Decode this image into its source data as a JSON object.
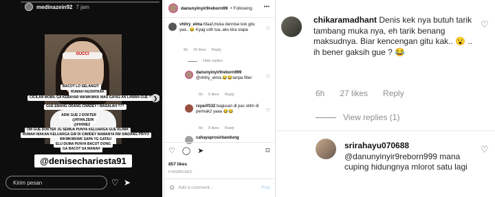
{
  "story": {
    "username": "medinazein92",
    "time": "7 jam",
    "headband": "GUCCI",
    "stickers": [
      "BACOT LO SELANGIT",
      "RUMAH NGONTRAK",
      "CICILAN MOBIL GA KEBAYAR WKWKWKK MAU GAYA2 AN LAWAN GUE ????",
      "GUE EMANG ORANG CIWIDEY ! MASALAH ???",
      "ADIK GUE 2 DOKTER",
      "@RYAN.ZEIN",
      "@FIKRIEZ",
      "OM GUE DOKTER JG SEMUA PUNYA KELUARGA GUE KLINIK",
      "RUMAH MAKAN KELUARGA GW DI CIWIDEY NAMANYA RM SINDANG PRIYO",
      "WKWKWKWK SAPA YG GATAU",
      "ELU DUMA PUNYA BACOT DONG",
      "GA BACOT SA MANAH"
    ],
    "mention_tag": "@denisechariesta91",
    "message_placeholder": "Kirim pesan"
  },
  "post": {
    "username": "danunyinyir9reborn99",
    "following": "• Following",
    "comments": [
      {
        "user": "vhitry_elma",
        "text": "Maaf,muka dennise kok gitu yaa.. 😂 Kyag udh tua..aku kira siapa",
        "time": "6h",
        "likes": "26 likes",
        "reply": "Reply"
      },
      {
        "view_label": "Hide replies"
      },
      {
        "user": "danunyinyir9reborn999",
        "text": "@vhitry_elma 😂😂tanpa filter",
        "time": "6h",
        "likes": "6 likes",
        "reply": "Reply"
      },
      {
        "user": "rsyarif132",
        "text": "bagusan dl pas sblm di permak2 yaaa 😂😂",
        "time": "6h",
        "likes": "8 likes",
        "reply": "Reply"
      },
      {
        "user": "cahayaprosirbandung",
        "text": ""
      }
    ],
    "likes_count": "857 likes",
    "date": "6 HOURS AGO",
    "add_comment_placeholder": "Add a comment...",
    "post_label": "Post"
  },
  "thread": {
    "top": {
      "user": "chikaramadhant",
      "text": "Denis kek nya butuh tarik tambang muka nya, eh tarik benang maksudnya. Biar kencengan gitu kak.. 😮 .. ih bener gaksih gue ? 😂",
      "time": "6h",
      "likes": "27 likes",
      "reply": "Reply",
      "view_replies": "View replies (1)"
    },
    "second": {
      "user": "srirahayu070688",
      "text": "@danunyinyir9reborn999 mana cuping hidungnya mlorot satu lagi"
    }
  }
}
